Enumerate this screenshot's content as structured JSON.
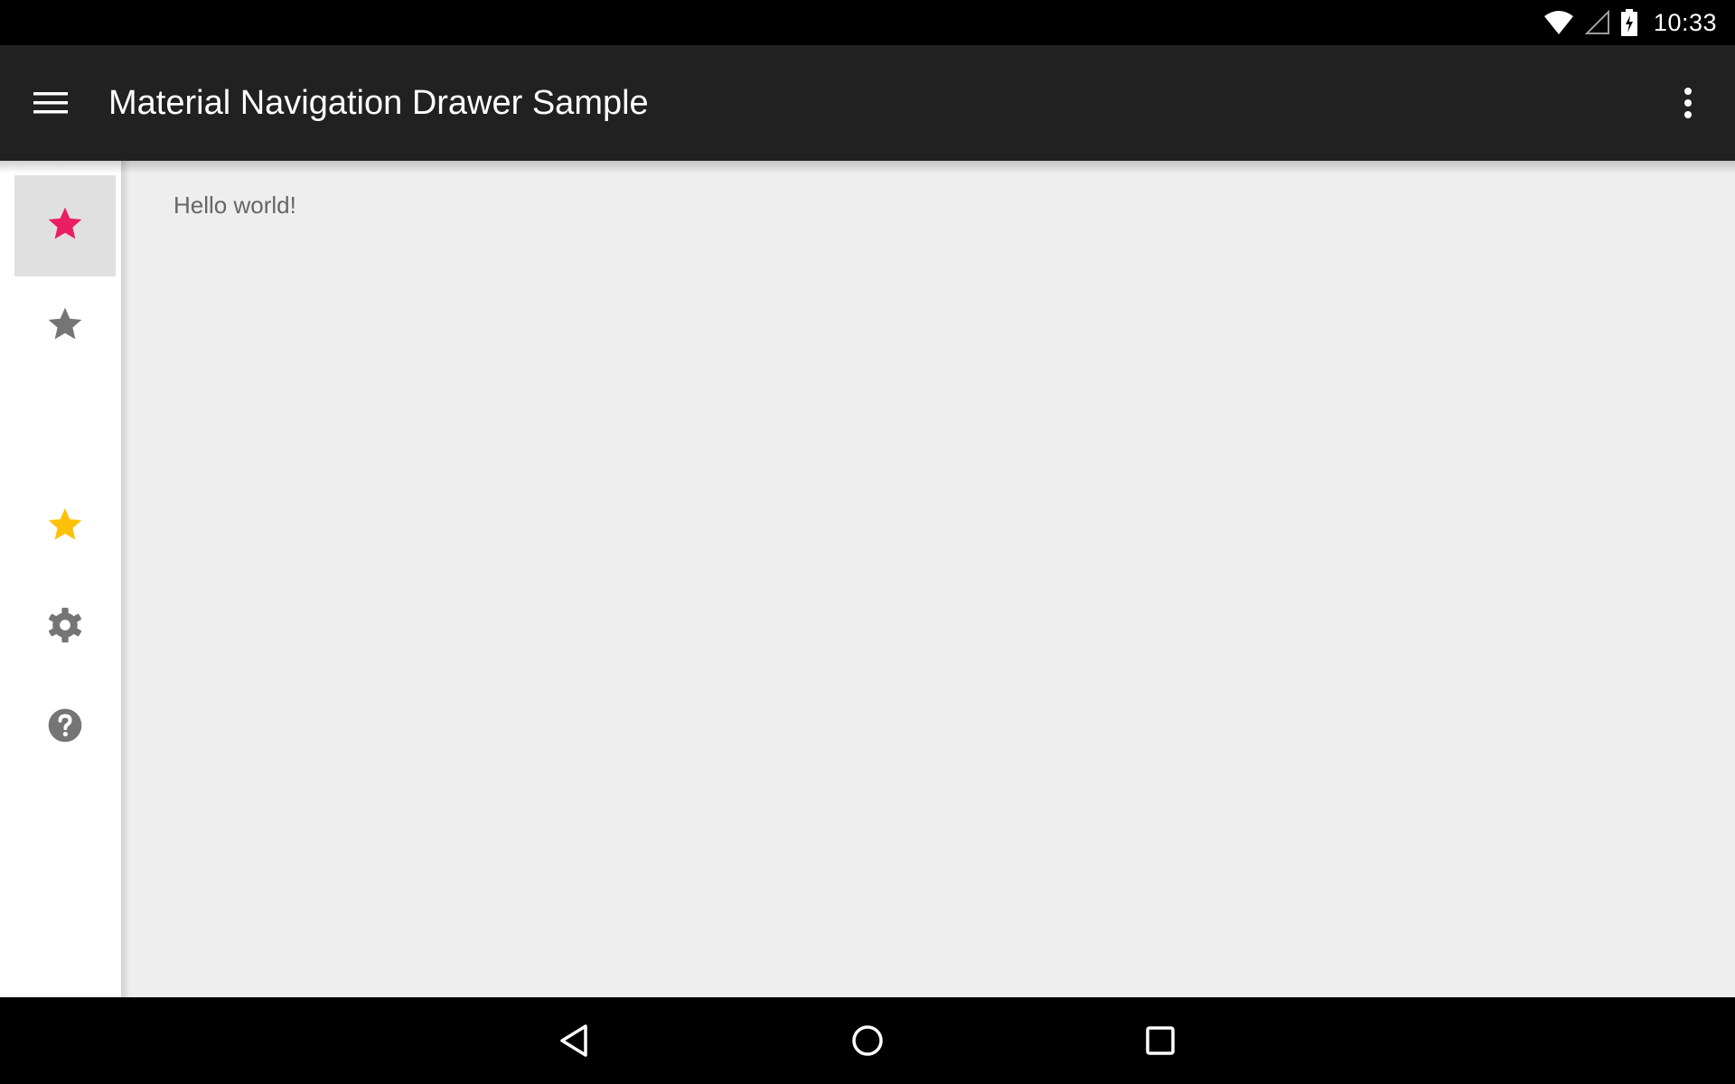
{
  "status_bar": {
    "time": "10:33",
    "icons": [
      "wifi-icon",
      "cellular-signal-icon",
      "battery-charging-icon"
    ]
  },
  "app_bar": {
    "title": "Material Navigation Drawer Sample",
    "menu_icon": "hamburger-menu-icon",
    "overflow_icon": "more-vert-icon",
    "background_color": "#212121"
  },
  "drawer": {
    "items": [
      {
        "icon": "star-icon",
        "color": "#e91e63",
        "selected": true
      },
      {
        "icon": "star-icon",
        "color": "#757575",
        "selected": false
      },
      {
        "icon": "star-icon",
        "color": "#ffc107",
        "selected": false
      },
      {
        "icon": "settings-gear-icon",
        "color": "#757575",
        "selected": false
      },
      {
        "icon": "help-icon",
        "color": "#757575",
        "selected": false
      }
    ],
    "selected_background": "#e0e0e0"
  },
  "main": {
    "text": "Hello world!",
    "background_color": "#eeeeee"
  },
  "nav_bar": {
    "buttons": [
      "back-icon",
      "home-icon",
      "recents-icon"
    ]
  }
}
